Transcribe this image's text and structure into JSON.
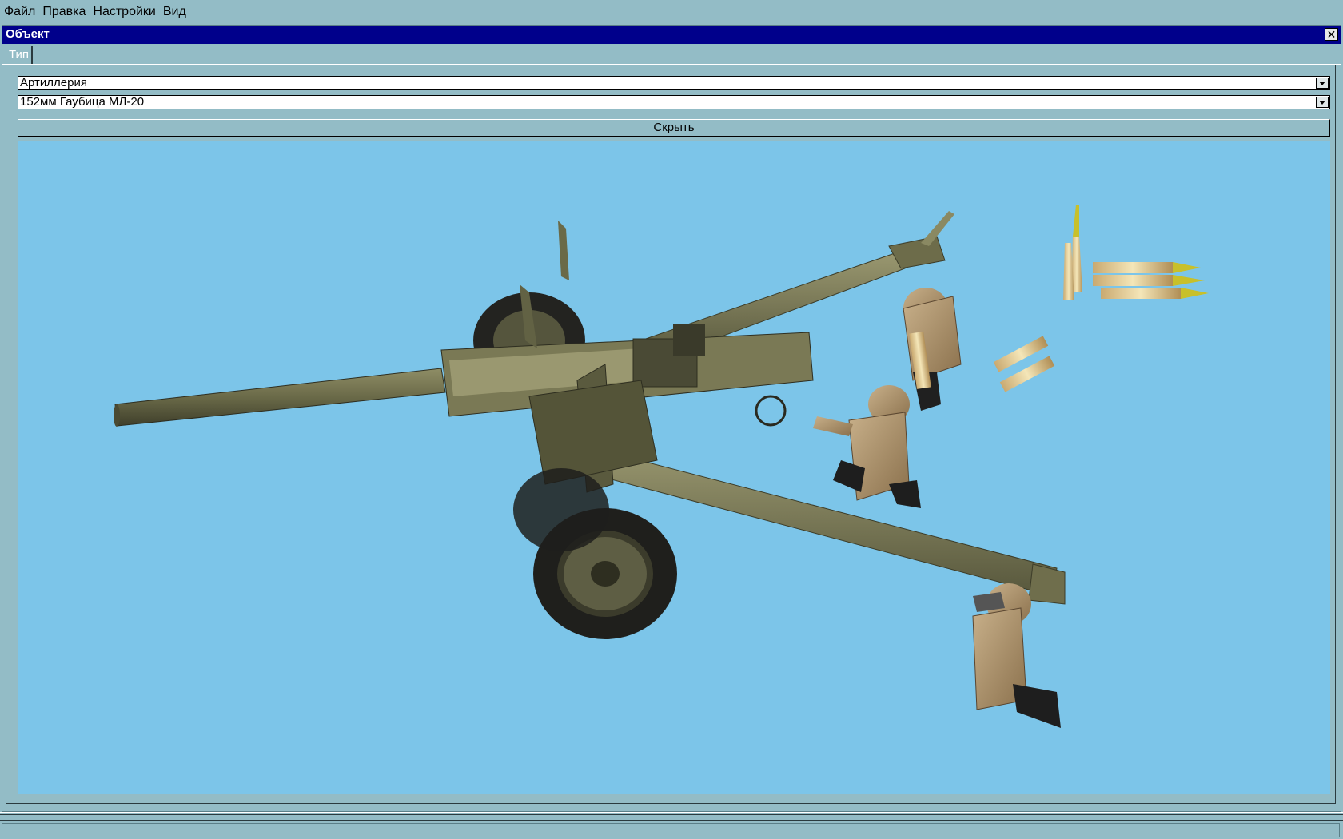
{
  "menu": {
    "items": [
      {
        "label": "Файл"
      },
      {
        "label": "Правка"
      },
      {
        "label": "Настройки"
      },
      {
        "label": "Вид"
      }
    ]
  },
  "window": {
    "title": "Объект",
    "close_icon": "close-icon",
    "title_color": "#00008b"
  },
  "tabs": [
    {
      "label": "Тип",
      "active": true
    }
  ],
  "form": {
    "category": {
      "value": "Артиллерия",
      "icon": "chevron-down-icon"
    },
    "model": {
      "value": "152мм Гаубица МЛ-20",
      "icon": "chevron-down-icon"
    },
    "hide_button": "Скрыть"
  },
  "viewport": {
    "background": "#7cc5e9"
  }
}
